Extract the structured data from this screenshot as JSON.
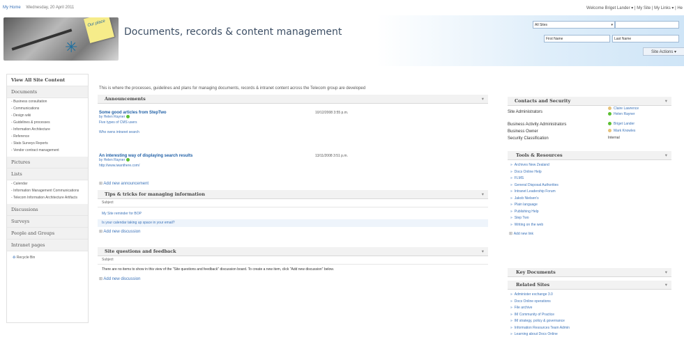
{
  "topbar": {
    "home": "My Home",
    "date": "Wednesday, 20 April 2011",
    "welcome": "Welcome Briget Lander ▾ | My Site | My Links ▾ | He"
  },
  "banner": {
    "title": "Documents, records & content management",
    "note_text": "Our place",
    "scope": "All Sites",
    "first_name": "First Name",
    "last_name": "Last Name",
    "site_actions": "Site Actions ▾"
  },
  "quicklaunch": {
    "view_all": "View All Site Content",
    "documents": "Documents",
    "documents_items": [
      "Business consultation",
      "Communications",
      "Design wiki",
      "Guidelines & processes",
      "Information Architecture",
      "Reference",
      "Stats Surveys Reports",
      "Vendor contract management"
    ],
    "pictures": "Pictures",
    "lists": "Lists",
    "lists_items": [
      "Calendar",
      "Information Management Communications",
      "Telecom Information Architecture Artifacts"
    ],
    "discussions": "Discussions",
    "surveys": "Surveys",
    "people": "People and Groups",
    "intranet": "Intranet pages",
    "recycle": "Recycle Bin"
  },
  "main": {
    "intro": "This is where the processes, guidelines and plans for managing documents, records & intranet content across the Telecom group are developed",
    "announcements": {
      "title": "Announcements",
      "items": [
        {
          "title": "Some good articles from StepTwo",
          "by": "by Helen Rayner",
          "date": "10/12/2008 3:55 p.m.",
          "links": [
            "Five types of CMS users",
            "Who owns intranet search"
          ]
        },
        {
          "title": "An interesting way of displaying search results",
          "by": "by Helen Rayner",
          "date": "13/11/2008 3:51 p.m.",
          "links": [
            "http://www.iwanthere.com/"
          ]
        }
      ],
      "add": "Add new announcement"
    },
    "tips": {
      "title": "Tips & tricks for managing information",
      "subject": "Subject",
      "rows": [
        "My Site reminder for BOP",
        "Is your calendar taking up space in your email?"
      ],
      "add": "Add new discussion"
    },
    "feedback": {
      "title": "Site questions and feedback",
      "subject": "Subject",
      "empty": "There are no items to show in this view of the \"Site questions and feedback\" discussion board. To create a new item, click \"Add new discussion\" below.",
      "add": "Add new discussion"
    }
  },
  "right": {
    "contacts": {
      "title": "Contacts and Security",
      "rows": [
        {
          "label": "Site Administrators",
          "values": [
            "Claire Lawrence",
            "Helen Rayner"
          ]
        },
        {
          "label": "Business Activity Administrators",
          "values": [
            "Briget Lander"
          ]
        },
        {
          "label": "Business Owner",
          "values": [
            "Mark Knowles"
          ]
        },
        {
          "label": "Security Classification",
          "values": [
            "Internal"
          ]
        }
      ]
    },
    "tools": {
      "title": "Tools & Resources",
      "items": [
        "Archives New Zealand",
        "Docs Online Help",
        "FLMS",
        "General Disposal Authorities",
        "Intranet Leadership Forum",
        "Jakob Nielsen's",
        "Plain language",
        "Publishing Help",
        "Step Two",
        "Writing on the web"
      ],
      "add": "Add new link"
    },
    "key_docs": {
      "title": "Key Documents"
    },
    "related": {
      "title": "Related Sites",
      "items": [
        "Administer exchange 3.0",
        "Docs Online operations",
        "File archive",
        "IM Community of Practice",
        "IM strategy, policy & governance",
        "Information Resources Team Admin",
        "Learning about Docs Online"
      ]
    }
  },
  "colors": {
    "link": "#3b73b9",
    "presence_online": "#5bbf32",
    "presence_away": "#e7c27a"
  },
  "icons": [
    "star-icon",
    "presence-icon",
    "add-icon",
    "recycle-bin-icon",
    "dropdown-arrow-icon"
  ]
}
